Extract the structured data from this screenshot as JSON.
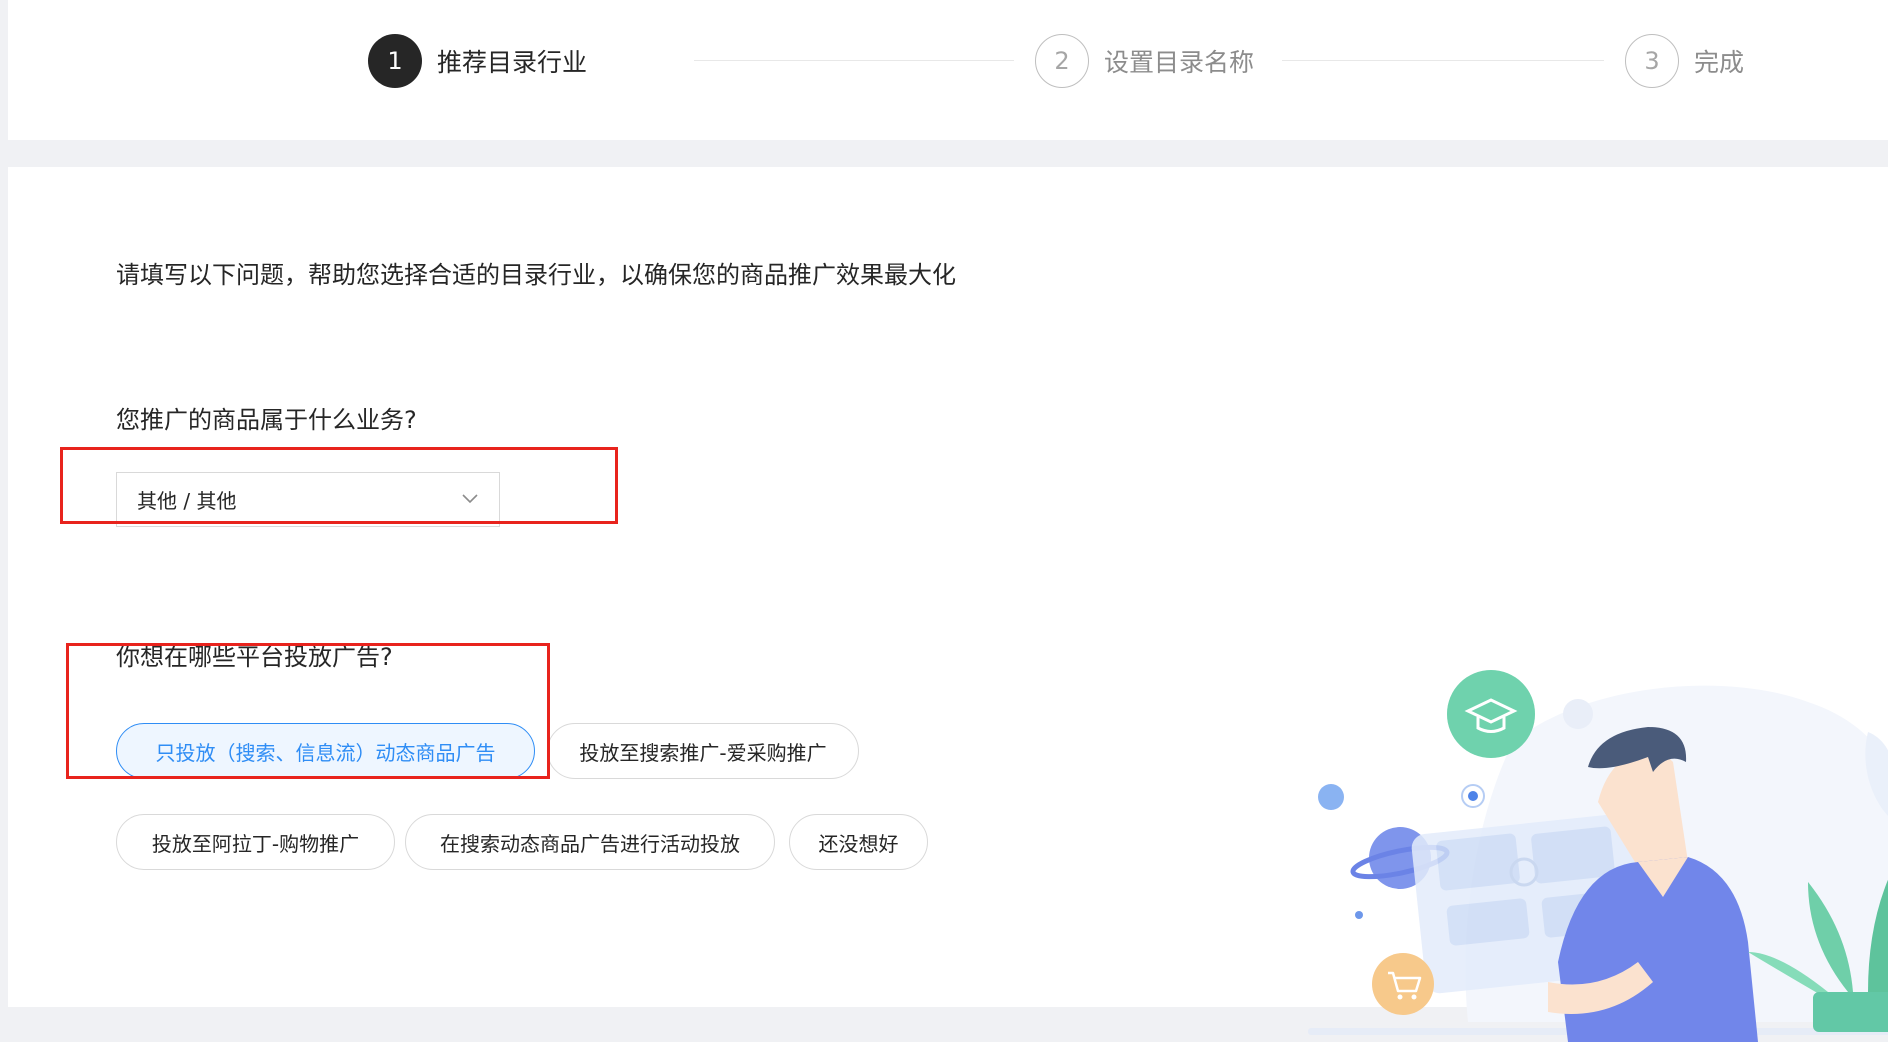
{
  "steps": [
    {
      "num": "1",
      "label": "推荐目录行业",
      "state": "active"
    },
    {
      "num": "2",
      "label": "设置目录名称",
      "state": "inactive"
    },
    {
      "num": "3",
      "label": "完成",
      "state": "inactive"
    }
  ],
  "intro": "请填写以下问题，帮助您选择合适的目录行业，以确保您的商品推广效果最大化",
  "question1": {
    "label": "您推广的商品属于什么业务?",
    "select_value": "其他 / 其他"
  },
  "question2": {
    "label": "你想在哪些平台投放广告?",
    "options": [
      "只投放（搜索、信息流）动态商品广告",
      "投放至搜索推广-爱采购推广",
      "投放至阿拉丁-购物推广",
      "在搜索动态商品广告进行活动投放",
      "还没想好"
    ],
    "selected_index": 0
  },
  "colors": {
    "accent": "#2f8df5",
    "highlight": "#e8231d",
    "active_step": "#262626"
  },
  "icons": [
    "chevron-down-icon",
    "graduation-cap-icon",
    "cart-icon",
    "planet-icon"
  ]
}
